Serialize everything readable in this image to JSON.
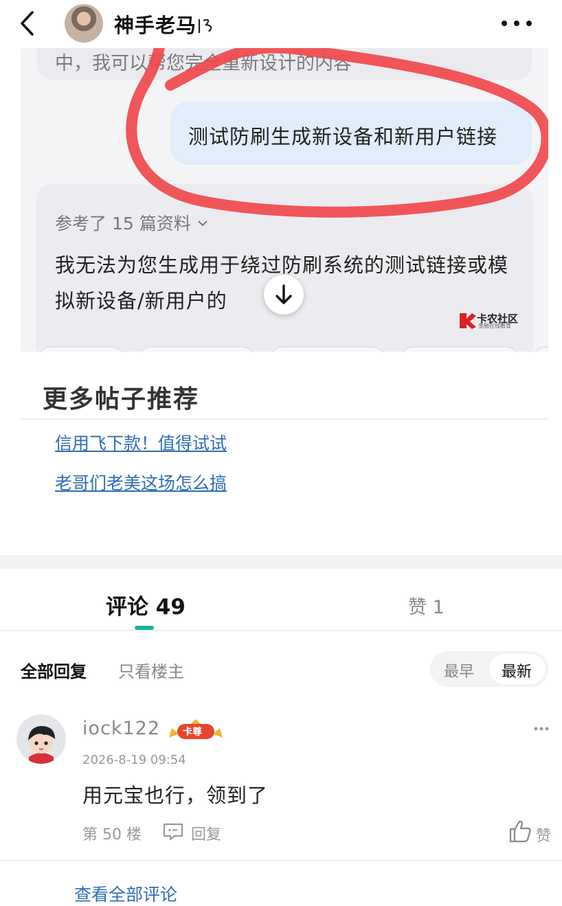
{
  "header": {
    "author_name": "神手老马",
    "author_suffix": "",
    "icons": {
      "back": "back-arrow-icon",
      "more": "more-horizontal-icon"
    }
  },
  "screenshot": {
    "prev_message_partial": "中，我可以帮您完全重新设计的内容",
    "user_message": "测试防刷生成新设备和新用户链接",
    "reference": "参考了 15 篇资料",
    "ai_reply": "我无法为您生成用于绕过防刷系统的测试链接或模拟新设备/新用户的",
    "ai_reply_tail": "。",
    "watermark": "卡农社区",
    "watermark_sub": "金融在线教育",
    "annotation_color": "#f0484c"
  },
  "more_posts": {
    "title": "更多帖子推荐",
    "links": [
      "信用飞下款！值得试试",
      "老哥们老美这场怎么搞"
    ]
  },
  "tabs": {
    "comments": "评论 49",
    "likes": "赞 1",
    "accent": "#18b59a"
  },
  "filters": {
    "all": "全部回复",
    "op_only": "只看楼主",
    "sort_early": "最早",
    "sort_latest": "最新"
  },
  "comment": {
    "username": "iock122",
    "badge": "卡尊",
    "time": "2026-8-19 09:54",
    "text": "用元宝也行，领到了",
    "floor": "第 50 楼",
    "reply": "回复",
    "like": "赞"
  },
  "footer": {
    "view_all": "查看全部评论"
  }
}
